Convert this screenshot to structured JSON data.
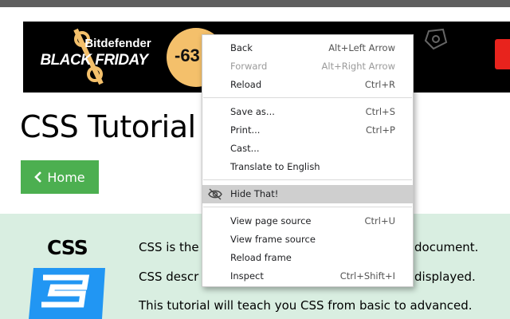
{
  "ad": {
    "brand": "Bitdefender",
    "promo": "BLACK FRIDAY",
    "discount": "-63"
  },
  "page": {
    "title": "CSS Tutorial",
    "home_button": "Home"
  },
  "content": {
    "logo_text": "CSS",
    "paragraphs": [
      {
        "lead": "CSS is the",
        "tail": "document."
      },
      {
        "lead": "CSS descr",
        "tail": "displayed."
      },
      {
        "lead": "This tutorial will teach you CSS from basic to advanced.",
        "tail": ""
      }
    ]
  },
  "context_menu": {
    "items": [
      {
        "label": "Back",
        "shortcut": "Alt+Left Arrow"
      },
      {
        "label": "Forward",
        "shortcut": "Alt+Right Arrow"
      },
      {
        "label": "Reload",
        "shortcut": "Ctrl+R"
      },
      {
        "label": "Save as...",
        "shortcut": "Ctrl+S"
      },
      {
        "label": "Print...",
        "shortcut": "Ctrl+P"
      },
      {
        "label": "Cast...",
        "shortcut": ""
      },
      {
        "label": "Translate to English",
        "shortcut": ""
      },
      {
        "label": "Hide That!",
        "shortcut": "",
        "icon": "eye-slash-icon"
      },
      {
        "label": "View page source",
        "shortcut": "Ctrl+U"
      },
      {
        "label": "View frame source",
        "shortcut": ""
      },
      {
        "label": "Reload frame",
        "shortcut": ""
      },
      {
        "label": "Inspect",
        "shortcut": "Ctrl+Shift+I"
      }
    ]
  },
  "colors": {
    "home_button": "#4caf50",
    "content_bg": "#d9eee1",
    "css_logo_blue": "#2196f3",
    "ad_discount": "#f4c06b",
    "ad_cta": "#e8231d",
    "menu_highlight": "#cfcfcf"
  }
}
